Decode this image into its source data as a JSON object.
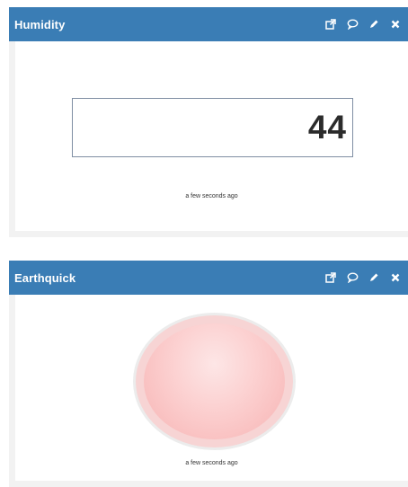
{
  "widgets": [
    {
      "title": "Humidity",
      "value": "44",
      "timestamp": "a few seconds ago"
    },
    {
      "title": "Earthquick",
      "timestamp": "a few seconds ago",
      "indicator_color": "#f8c6c6"
    }
  ],
  "header_icons": [
    "external-link-icon",
    "comment-icon",
    "pencil-icon",
    "close-icon"
  ],
  "colors": {
    "header": "#3a7db5",
    "panel_bg": "#f2f2f2",
    "value_border": "#7f8ea3"
  }
}
